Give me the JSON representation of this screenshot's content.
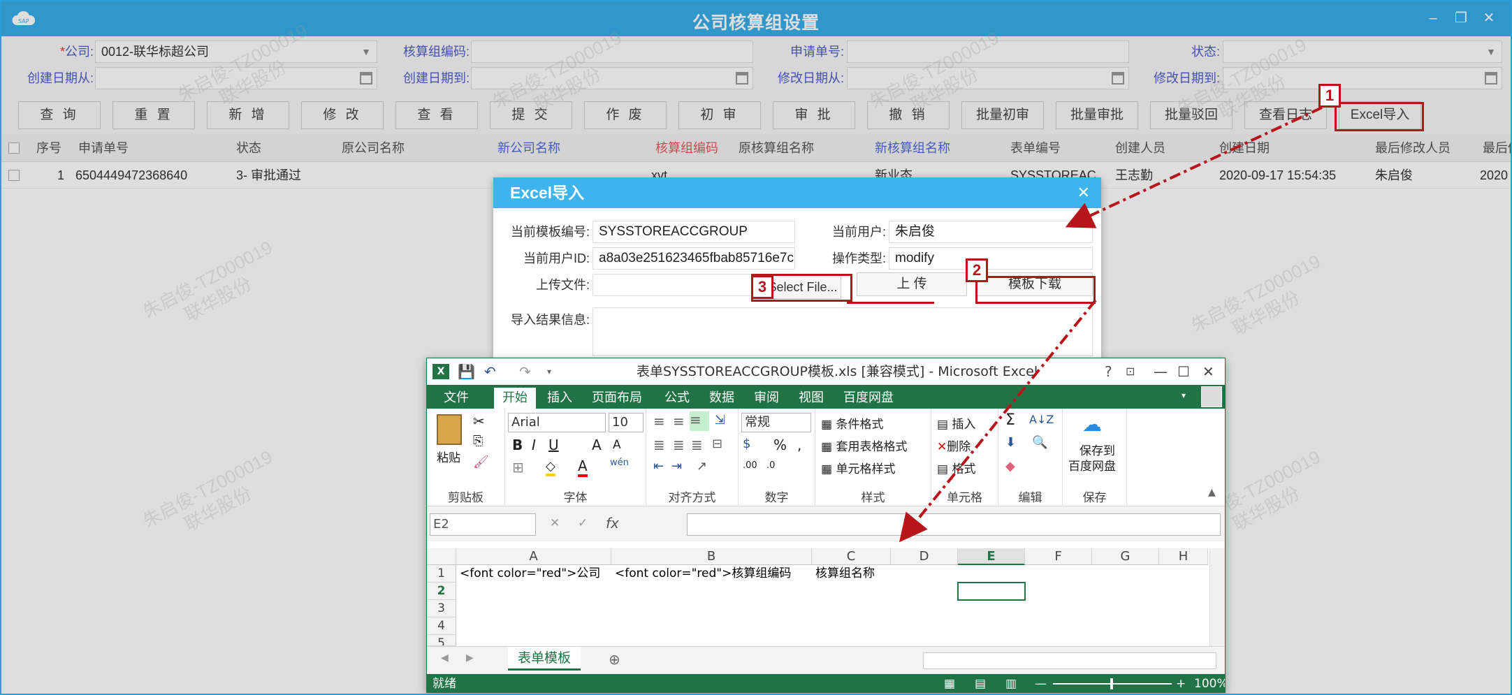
{
  "window": {
    "title": "公司核算组设置"
  },
  "form": {
    "company_label": "*公司:",
    "company_value": "0012-联华标超公司",
    "group_code_label": "核算组编码:",
    "request_no_label": "申请单号:",
    "status_label": "状态:",
    "created_from_label": "创建日期从:",
    "created_to_label": "创建日期到:",
    "modified_from_label": "修改日期从:",
    "modified_to_label": "修改日期到:"
  },
  "toolbar": [
    "查 询",
    "重 置",
    "新 增",
    "修 改",
    "查 看",
    "提 交",
    "作 废",
    "初 审",
    "审 批",
    "撤 销",
    "批量初审",
    "批量审批",
    "批量驳回",
    "查看日志",
    "Excel导入"
  ],
  "grid": {
    "columns": [
      "序号",
      "申请单号",
      "状态",
      "原公司名称",
      "新公司名称",
      "核算组编码",
      "原核算组名称",
      "新核算组名称",
      "表单编号",
      "创建人员",
      "创建日期",
      "最后修改人员",
      "最后修"
    ],
    "rows": [
      [
        "1",
        "6504449472368640",
        "3- 审批通过",
        "",
        "",
        "xvt",
        "",
        "新业态",
        "SYSSTOREAC",
        "王志勤",
        "2020-09-17 15:54:35",
        "朱启俊",
        "2020"
      ]
    ]
  },
  "watermark": {
    "line1": "朱启俊-TZ000019",
    "line2": "联华股份"
  },
  "dialog": {
    "title": "Excel导入",
    "template_no_label": "当前模板编号:",
    "template_no": "SYSSTOREACCGROUP",
    "current_user_label": "当前用户:",
    "current_user": "朱启俊",
    "user_id_label": "当前用户ID:",
    "user_id": "a8a03e251623465fbab85716e7c",
    "op_type_label": "操作类型:",
    "op_type": "modify",
    "upload_label": "上传文件:",
    "select_file": "Select File...",
    "upload_btn": "上 传",
    "download_btn": "模板下载",
    "result_label": "导入结果信息:"
  },
  "callouts": [
    "1",
    "2",
    "3"
  ],
  "excel": {
    "title": "表单SYSSTOREACCGROUP模板.xls  [兼容模式] - Microsoft Excel",
    "tabs": [
      "文件",
      "开始",
      "插入",
      "页面布局",
      "公式",
      "数据",
      "审阅",
      "视图",
      "百度网盘"
    ],
    "font_name": "Arial",
    "font_size": "10",
    "number_format": "常规",
    "groups": {
      "clipboard": "剪贴板",
      "font": "字体",
      "align": "对齐方式",
      "number": "数字",
      "style": "样式",
      "cells": "单元格",
      "edit": "编辑",
      "save": "保存"
    },
    "paste": "粘贴",
    "cond_format": "条件格式",
    "table_format": "套用表格格式",
    "cell_style": "单元格样式",
    "insert": "插入",
    "delete": "删除",
    "format": "格式",
    "save_line1": "保存到",
    "save_line2": "百度网盘",
    "name_box": "E2",
    "fx": "fx",
    "columns": [
      "A",
      "B",
      "C",
      "D",
      "E",
      "F",
      "G",
      "H"
    ],
    "rows": [
      "1",
      "2",
      "3",
      "4",
      "5"
    ],
    "cell_a1": "<font color=\"red\">公司",
    "cell_b1": "<font color=\"red\">核算组编码",
    "cell_c1": "核算组名称",
    "sheet_tab": "表单模板",
    "status_ready": "就绪",
    "zoom": "100%"
  },
  "colors": {
    "accent": "#39aee8",
    "excel_green": "#217346",
    "callout": "#b7151a"
  }
}
